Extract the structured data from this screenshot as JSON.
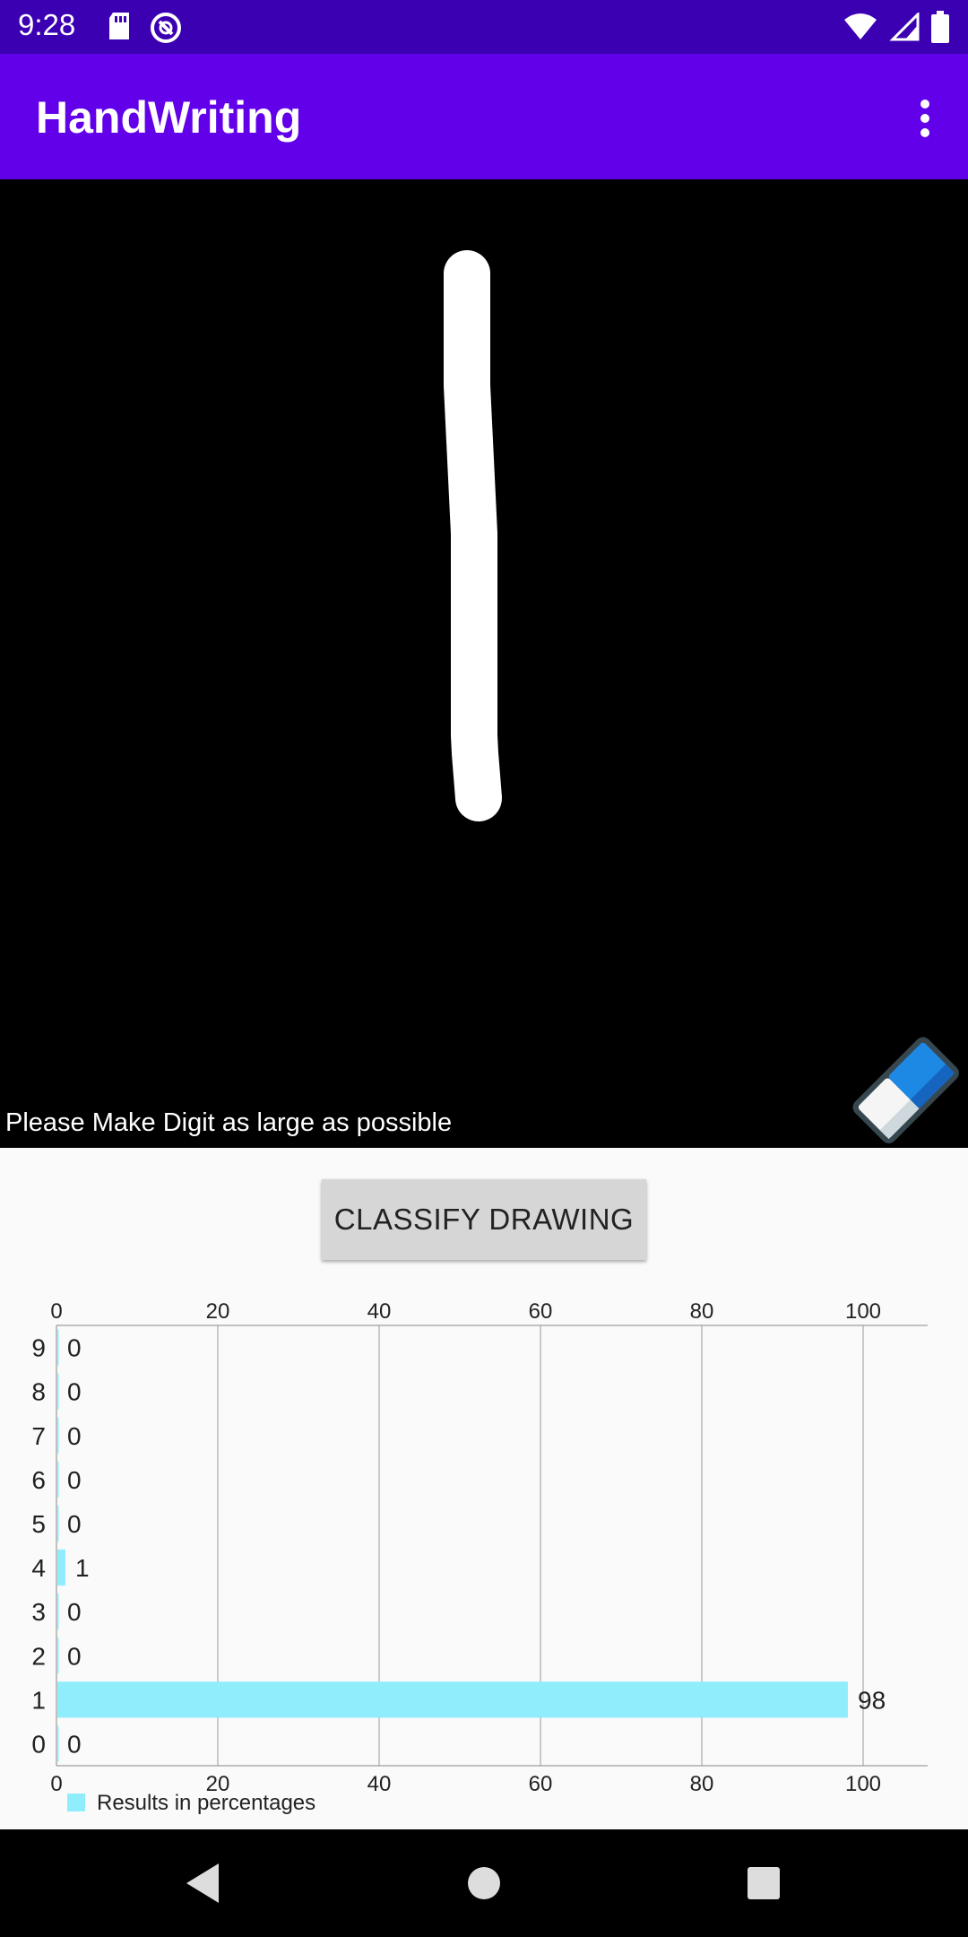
{
  "status_bar": {
    "time": "9:28",
    "icons_left": [
      "sd-card-icon",
      "sync-icon"
    ],
    "icons_right": [
      "wifi-icon",
      "cell-signal-icon",
      "battery-icon"
    ],
    "background": "#3a00b2"
  },
  "app_bar": {
    "title": "HandWriting",
    "overflow_icon": "more-vert-icon",
    "background": "#6200ea"
  },
  "canvas": {
    "hint": "Please Make Digit as large as possible",
    "eraser_icon": "eraser-icon"
  },
  "actions": {
    "classify_label": "CLASSIFY DRAWING"
  },
  "chart_data": {
    "type": "bar",
    "orientation": "horizontal",
    "categories": [
      "0",
      "1",
      "2",
      "3",
      "4",
      "5",
      "6",
      "7",
      "8",
      "9"
    ],
    "values": [
      0,
      98,
      0,
      0,
      1,
      0,
      0,
      0,
      0,
      0
    ],
    "value_labels": [
      "0",
      "98",
      "0",
      "0",
      "1",
      "0",
      "0",
      "0",
      "0",
      "0"
    ],
    "xlim": [
      0,
      108
    ],
    "ticks": [
      "0",
      "20",
      "40",
      "60",
      "80",
      "100"
    ],
    "tick_values": [
      0,
      20,
      40,
      60,
      80,
      100
    ],
    "legend": "Results in percentages",
    "color": "#90eefc",
    "grid": true,
    "legend_position": "bottom-left"
  },
  "nav_bar": {
    "back": "back-icon",
    "home": "home-icon",
    "recents": "recents-icon"
  }
}
